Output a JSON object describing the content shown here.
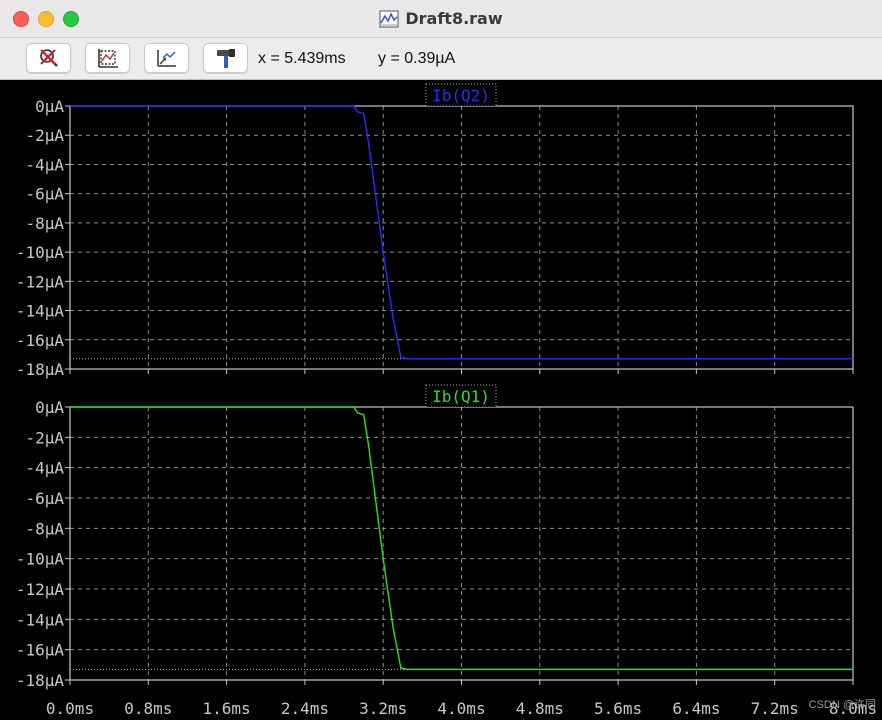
{
  "window": {
    "title": "Draft8.raw"
  },
  "toolbar": {
    "buttons": [
      {
        "icon": "zoom-cancel-icon"
      },
      {
        "icon": "autorange-icon"
      },
      {
        "icon": "paste-trace-icon"
      },
      {
        "icon": "hammer-icon"
      }
    ],
    "cursor_x": "x = 5.439ms",
    "cursor_y": "y = 0.39µA"
  },
  "watermark": "CSDN @许同",
  "colors": {
    "q2": "#2a2cff",
    "q1": "#22e622",
    "grid": "#8c8c8c",
    "axis": "#c8c8c8"
  },
  "chart_data": [
    {
      "type": "line",
      "title": "Ib(Q2)",
      "xlabel": "",
      "ylabel": "",
      "x_ticks": [
        "0.0ms",
        "0.8ms",
        "1.6ms",
        "2.4ms",
        "3.2ms",
        "4.0ms",
        "4.8ms",
        "5.6ms",
        "6.4ms",
        "7.2ms",
        "8.0ms"
      ],
      "y_ticks": [
        "0µA",
        "-2µA",
        "-4µA",
        "-6µA",
        "-8µA",
        "-10µA",
        "-12µA",
        "-14µA",
        "-16µA",
        "-18µA"
      ],
      "xlim": [
        0,
        8.0
      ],
      "ylim": [
        -18,
        0
      ],
      "grid": true,
      "series": [
        {
          "name": "Ib(Q2)",
          "color": "#2a2cff",
          "x": [
            0,
            2.9,
            2.94,
            3.0,
            3.05,
            3.1,
            3.2,
            3.3,
            3.38,
            3.45,
            8.0
          ],
          "y": [
            0,
            0,
            -0.4,
            -0.5,
            -2.5,
            -5.0,
            -10.0,
            -14.5,
            -17.2,
            -17.3,
            -17.3
          ]
        }
      ],
      "reference_level": -17.3
    },
    {
      "type": "line",
      "title": "Ib(Q1)",
      "xlabel": "",
      "ylabel": "",
      "x_ticks": [
        "0.0ms",
        "0.8ms",
        "1.6ms",
        "2.4ms",
        "3.2ms",
        "4.0ms",
        "4.8ms",
        "5.6ms",
        "6.4ms",
        "7.2ms",
        "8.0ms"
      ],
      "y_ticks": [
        "0µA",
        "-2µA",
        "-4µA",
        "-6µA",
        "-8µA",
        "-10µA",
        "-12µA",
        "-14µA",
        "-16µA",
        "-18µA"
      ],
      "xlim": [
        0,
        8.0
      ],
      "ylim": [
        -18,
        0
      ],
      "grid": true,
      "series": [
        {
          "name": "Ib(Q1)",
          "color": "#22e622",
          "x": [
            0,
            2.9,
            2.94,
            3.0,
            3.05,
            3.1,
            3.2,
            3.3,
            3.38,
            3.45,
            8.0
          ],
          "y": [
            0,
            0,
            -0.4,
            -0.5,
            -2.5,
            -5.0,
            -10.0,
            -14.5,
            -17.2,
            -17.3,
            -17.3
          ]
        }
      ],
      "reference_level": -17.3
    }
  ]
}
